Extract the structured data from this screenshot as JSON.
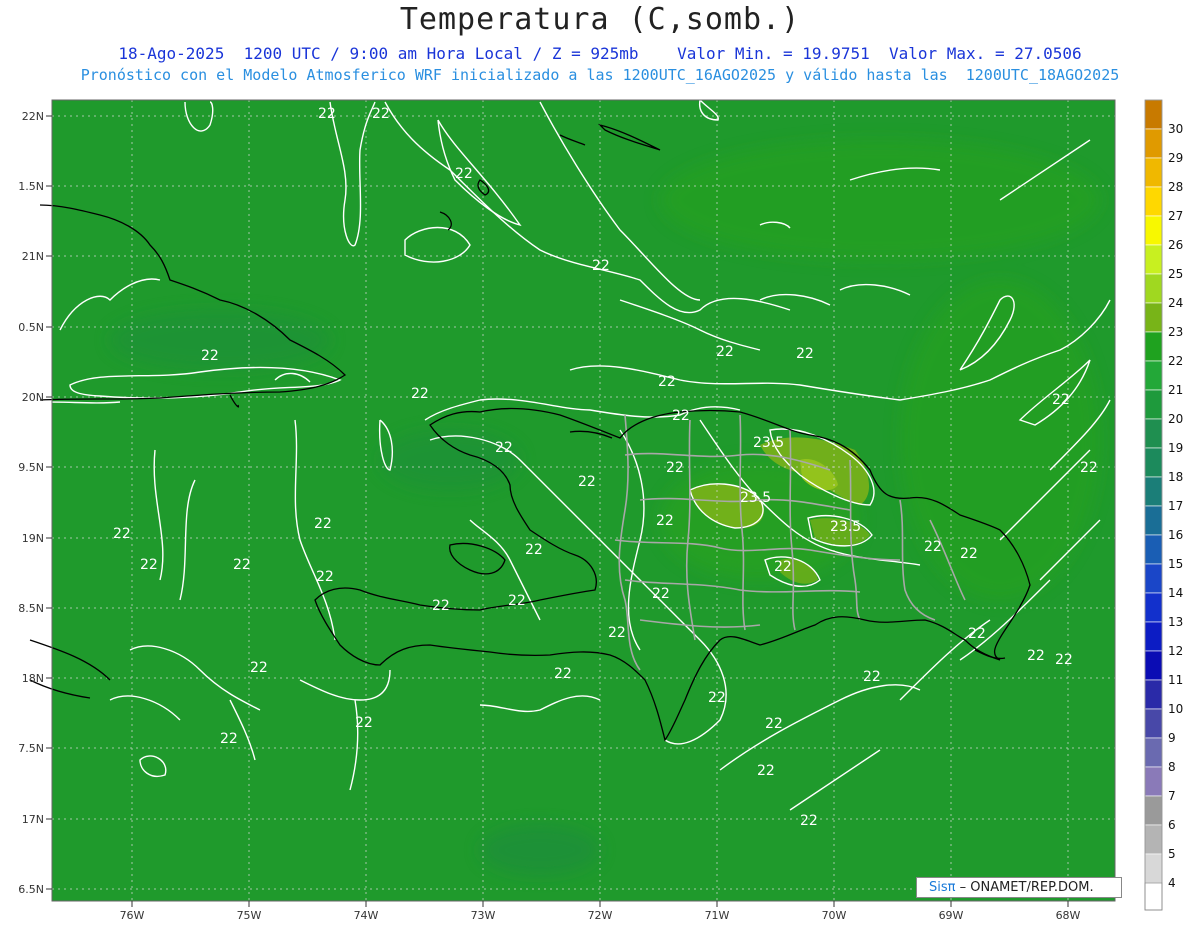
{
  "title": "Temperatura (C,somb.)",
  "subtitle1": "18-Ago-2025  1200 UTC / 9:00 am Hora Local / Z = 925mb    Valor Min. = 19.9751  Valor Max. = 27.0506",
  "subtitle2": "Pronóstico con el Modelo Atmosferico WRF inicializado a las 1200UTC_16AGO2025 y válido hasta las  1200UTC_18AGO2025",
  "latitude_ticks": [
    "22N",
    "1.5N",
    "21N",
    "0.5N",
    "20N",
    "9.5N",
    "19N",
    "8.5N",
    "18N",
    "7.5N",
    "17N",
    "6.5N"
  ],
  "longitude_ticks": [
    "76W",
    "75W",
    "74W",
    "73W",
    "72W",
    "71W",
    "70W",
    "69W",
    "68W"
  ],
  "colorbar": {
    "levels": [
      30,
      29,
      28,
      27,
      26,
      25,
      24,
      23,
      22,
      21,
      20,
      19,
      18,
      17,
      16,
      15,
      14,
      13,
      12,
      11,
      10,
      9,
      8,
      7,
      6,
      5,
      4
    ],
    "colors": [
      "#c87a00",
      "#e09a00",
      "#f0b800",
      "#ffd800",
      "#f8f800",
      "#c8f020",
      "#a0d820",
      "#78b418",
      "#1fa21f",
      "#23a838",
      "#1e9a3c",
      "#1f8f50",
      "#1c8a5c",
      "#1b7e78",
      "#1a6e96",
      "#1a5eb4",
      "#1a46c8",
      "#1230cc",
      "#0c1cc4",
      "#0a0cb4",
      "#2a2aa8",
      "#4848a8",
      "#6a6ab0",
      "#8a7ab8",
      "#9a9a9a",
      "#b4b4b4",
      "#d8d8d8"
    ],
    "bottom_color": "#ffffff"
  },
  "contour_labels": [
    {
      "text": "22"
    },
    {
      "text": "22"
    },
    {
      "text": "22"
    },
    {
      "text": "22"
    },
    {
      "text": "22"
    },
    {
      "text": "22"
    },
    {
      "text": "22"
    },
    {
      "text": "22"
    },
    {
      "text": "22"
    },
    {
      "text": "22"
    },
    {
      "text": "22"
    },
    {
      "text": "22"
    },
    {
      "text": "22"
    },
    {
      "text": "22"
    },
    {
      "text": "22"
    },
    {
      "text": "22"
    },
    {
      "text": "22"
    },
    {
      "text": "22"
    },
    {
      "text": "22"
    },
    {
      "text": "22"
    },
    {
      "text": "22"
    },
    {
      "text": "22"
    },
    {
      "text": "22"
    },
    {
      "text": "22"
    },
    {
      "text": "22"
    },
    {
      "text": "22"
    },
    {
      "text": "22"
    },
    {
      "text": "22"
    },
    {
      "text": "22"
    },
    {
      "text": "22"
    },
    {
      "text": "22"
    },
    {
      "text": "22"
    },
    {
      "text": "22"
    },
    {
      "text": "22"
    },
    {
      "text": "22"
    },
    {
      "text": "22"
    },
    {
      "text": "22"
    },
    {
      "text": "23.5"
    },
    {
      "text": "23.5"
    },
    {
      "text": "23.5"
    }
  ],
  "logo": {
    "brand": "Sisπ",
    "text": " – ONAMET/REP.DOM."
  },
  "colors": {
    "background_field": "#1f9a2c",
    "contour": "#ffffff",
    "coast": "#000000",
    "provinces": "#9a9a9a"
  }
}
